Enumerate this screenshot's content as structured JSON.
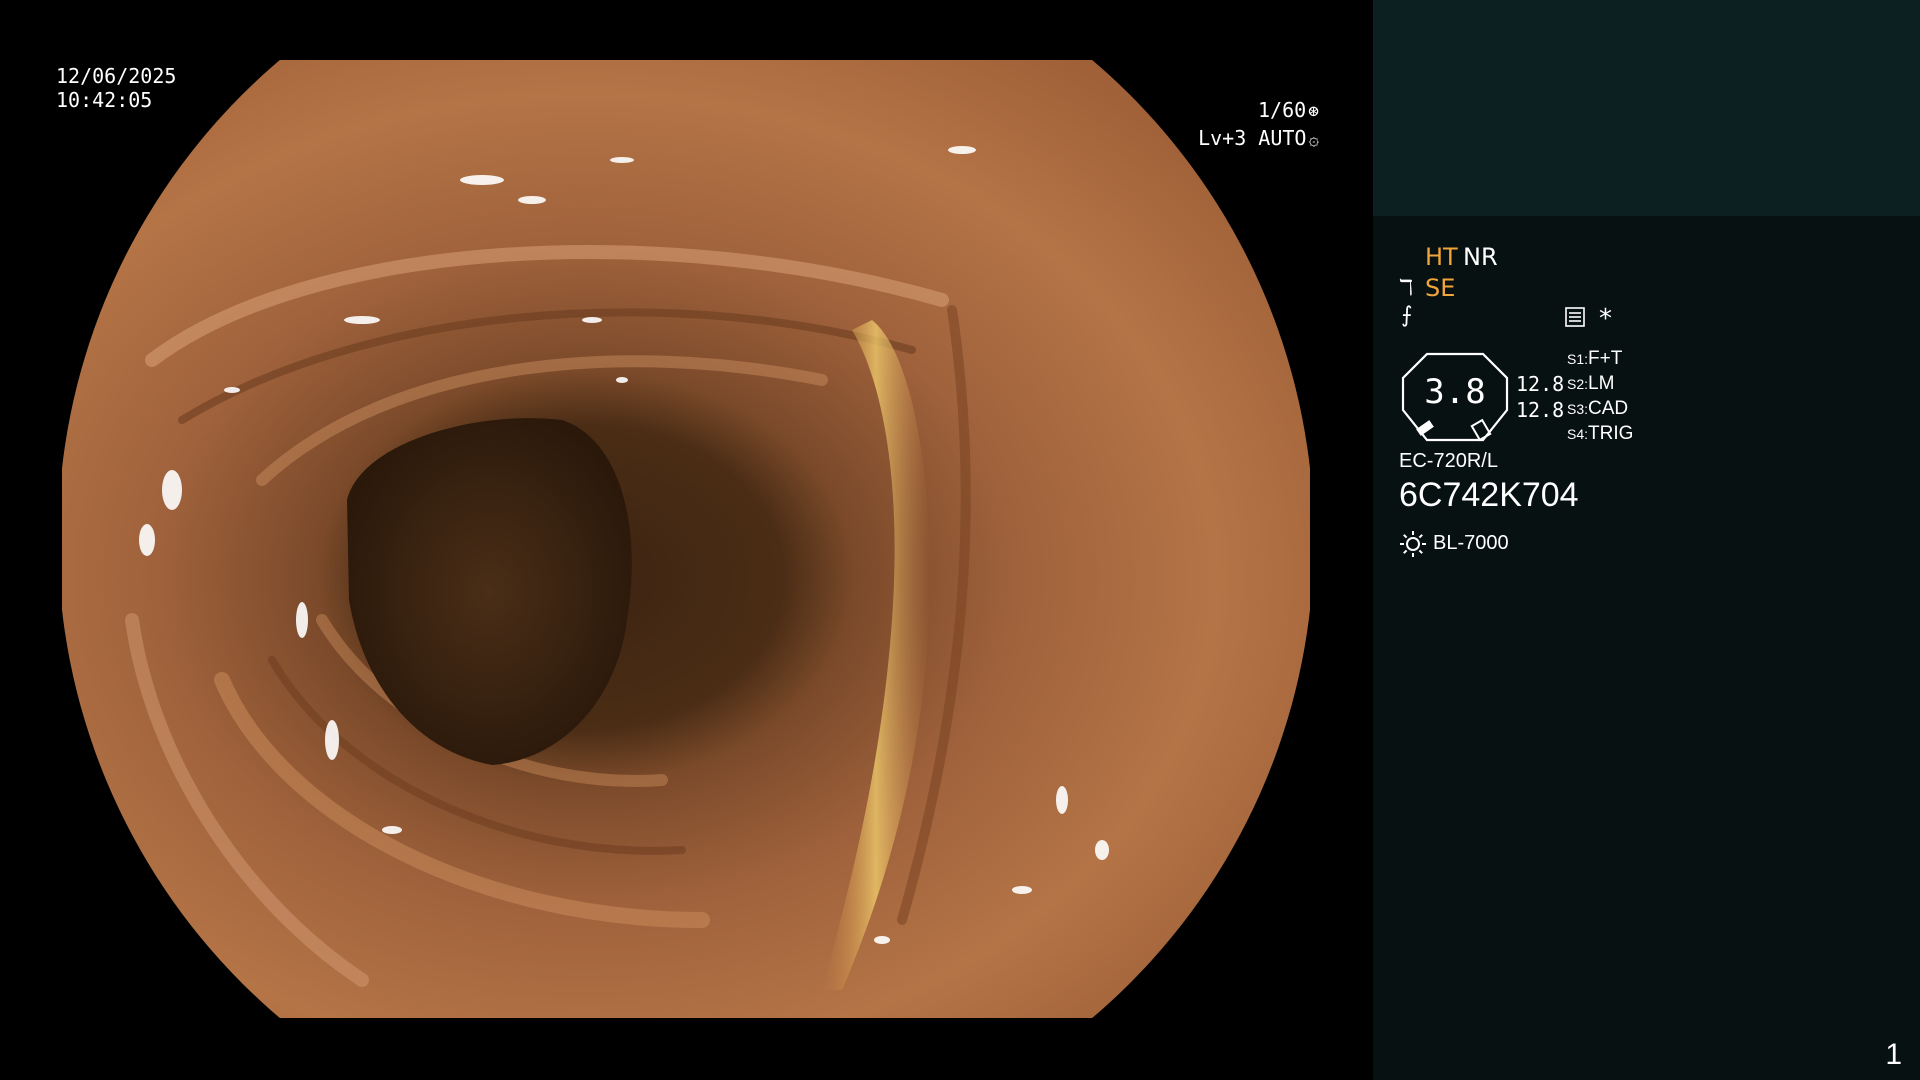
{
  "overlay": {
    "date": "12/06/2025",
    "time": "10:42:05",
    "shutter": "1/60",
    "iris": "Lv+3 AUTO",
    "shutter_icon": "aperture-icon",
    "iris_icon": "iris-icon"
  },
  "panel": {
    "ht": "HT",
    "nr": "NR",
    "se": "SE",
    "se_icon": "scope-tip-icon",
    "f_icon": "enhancement-icon",
    "menu_icon": "menu-icon",
    "star": "*",
    "gauge_value": "3.8",
    "value_1": "12.8",
    "value_2": "12.8",
    "switches": [
      {
        "key": "S1:",
        "value": "F+T"
      },
      {
        "key": "S2:",
        "value": "LM"
      },
      {
        "key": "S3:",
        "value": "CAD"
      },
      {
        "key": "S4:",
        "value": "TRIG"
      }
    ],
    "scope_model": "EC-720R/L",
    "serial": "6C742K704",
    "light_source": "BL-7000",
    "light_icon": "light-source-icon",
    "page_number": "1"
  },
  "colors": {
    "accent_orange": "#f0a53a",
    "panel_bg": "#071112",
    "panel_top_bg": "#0c1f21"
  }
}
